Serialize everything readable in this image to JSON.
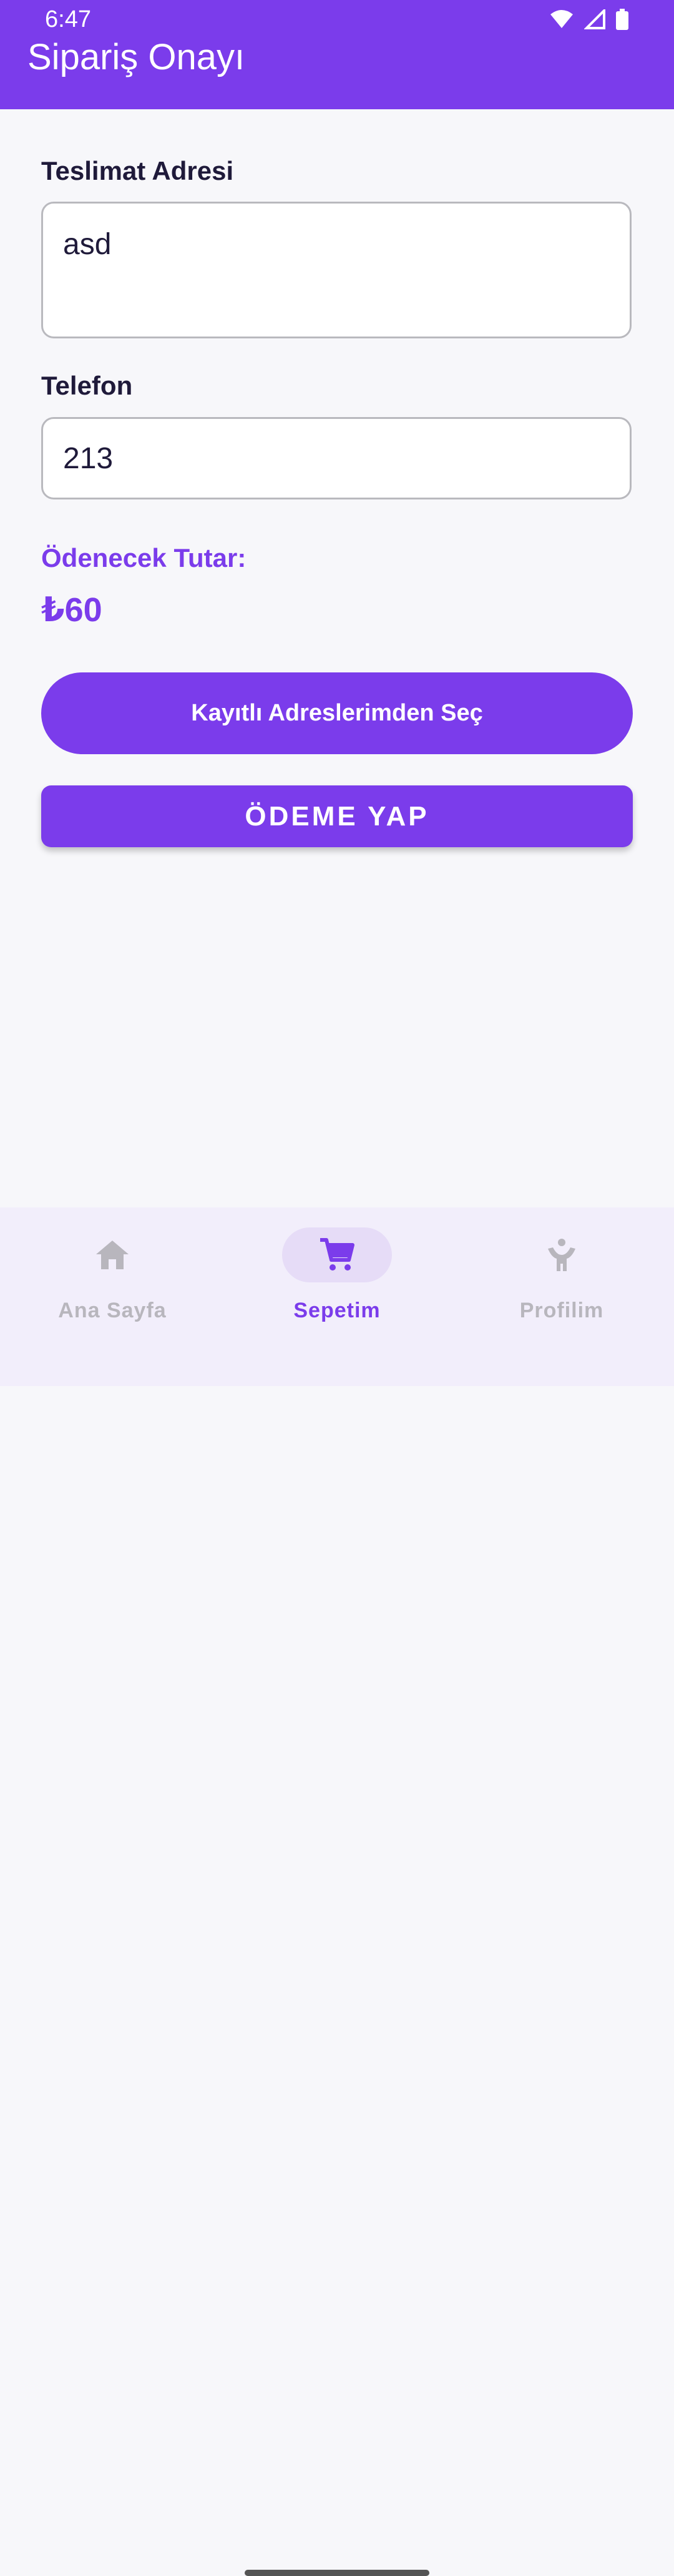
{
  "status_bar": {
    "time": "6:47",
    "icons": [
      "wifi-icon",
      "signal-icon",
      "battery-icon"
    ]
  },
  "app_bar": {
    "title": "Sipariş Onayı"
  },
  "form": {
    "address_label": "Teslimat Adresi",
    "address_value": "asd",
    "phone_label": "Telefon",
    "phone_value": "213"
  },
  "payment": {
    "amount_label": "Ödenecek Tutar:",
    "amount_value": "₺60"
  },
  "buttons": {
    "saved_addresses": "Kayıtlı Adreslerimden Seç",
    "pay": "ÖDEME YAP"
  },
  "bottom_nav": {
    "items": [
      {
        "label": "Ana Sayfa",
        "icon": "home-icon",
        "active": false
      },
      {
        "label": "Sepetim",
        "icon": "cart-icon",
        "active": true
      },
      {
        "label": "Profilim",
        "icon": "person-icon",
        "active": false
      }
    ]
  },
  "colors": {
    "accent": "#7b3ceb",
    "background": "#f7f7fa",
    "nav_background": "#f2eefb"
  }
}
